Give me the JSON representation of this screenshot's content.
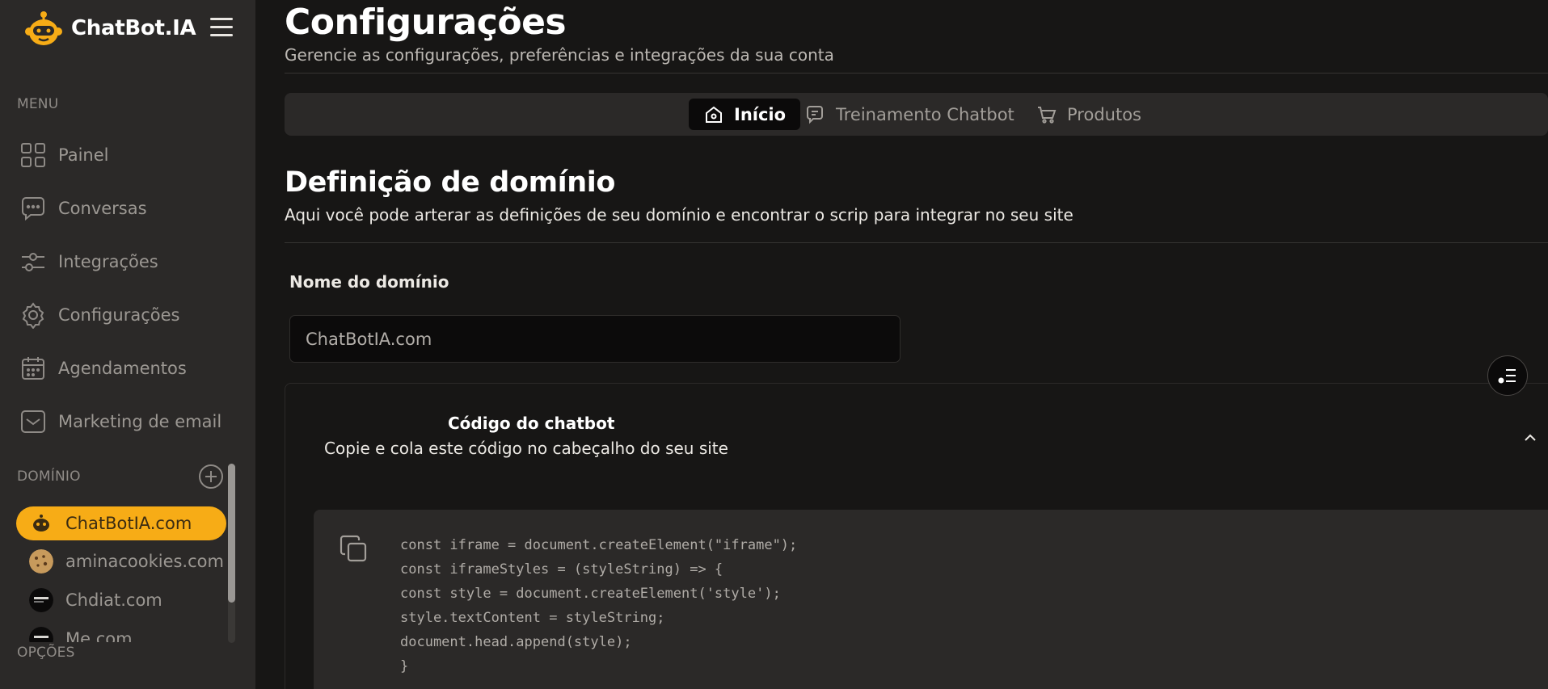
{
  "brand": {
    "name": "ChatBot.IA"
  },
  "sidebar": {
    "menu_label": "MENU",
    "items": [
      {
        "label": "Painel",
        "icon": "dashboard-icon"
      },
      {
        "label": "Conversas",
        "icon": "chat-bubble-icon"
      },
      {
        "label": "Integrações",
        "icon": "sliders-icon"
      },
      {
        "label": "Configurações",
        "icon": "gear-icon"
      },
      {
        "label": "Agendamentos",
        "icon": "calendar-icon"
      },
      {
        "label": "Marketing de email",
        "icon": "mail-icon"
      }
    ],
    "domain_label": "DOMÍNIO",
    "domains": [
      {
        "label": "ChatBotIA.com",
        "active": true
      },
      {
        "label": "aminacookies.com",
        "active": false
      },
      {
        "label": "Chdiat.com",
        "active": false
      },
      {
        "label": "Me.com",
        "active": false
      }
    ],
    "options_label": "OPÇÕES"
  },
  "header": {
    "title": "Configurações",
    "subtitle": "Gerencie as configurações, preferências e integrações da sua conta"
  },
  "tabs": [
    {
      "label": "Início",
      "active": true,
      "icon": "home-icon"
    },
    {
      "label": "Treinamento Chatbot",
      "active": false,
      "icon": "chat-training-icon"
    },
    {
      "label": "Produtos",
      "active": false,
      "icon": "cart-icon"
    }
  ],
  "domain_section": {
    "title": "Definição de domínio",
    "description": "Aqui você pode arterar as definições de seu domínio e encontrar o scrip para integrar no seu site",
    "field_label": "Nome do domínio",
    "field_value": "ChatBotIA.com"
  },
  "code_section": {
    "title": "Código do chatbot",
    "description": "Copie e cola este código no cabeçalho do seu site",
    "lines": [
      "const iframe = document.createElement(\"iframe\");",
      "const iframeStyles = (styleString) => {",
      "const style = document.createElement('style');",
      "style.textContent = styleString;",
      "document.head.append(style);",
      "}"
    ]
  },
  "colors": {
    "accent": "#f7ac16",
    "sidebar_bg": "#2b2928",
    "page_bg": "#171615"
  }
}
